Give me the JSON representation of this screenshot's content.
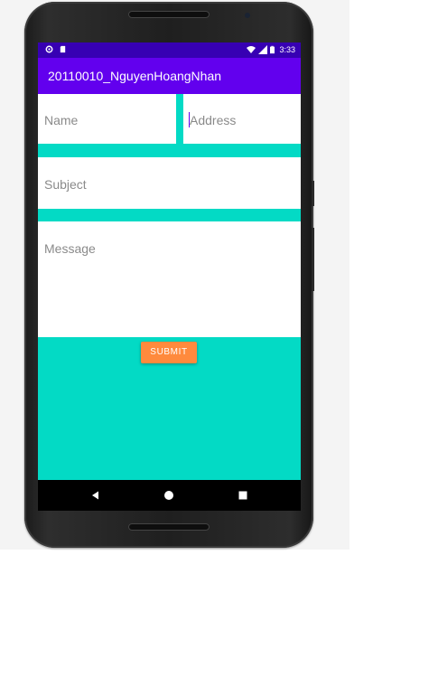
{
  "status_bar": {
    "left_icons": [
      "settings-gear-icon",
      "sd-card-icon"
    ],
    "right_icons": [
      "wifi-icon",
      "signal-icon",
      "battery-icon"
    ],
    "time": "3:33"
  },
  "app_bar": {
    "title": "20110010_NguyenHoangNhan"
  },
  "form": {
    "name": {
      "value": "",
      "placeholder": "Name"
    },
    "address": {
      "value": "",
      "placeholder": "Address"
    },
    "subject": {
      "value": "",
      "placeholder": "Subject"
    },
    "message": {
      "value": "",
      "placeholder": "Message"
    },
    "submit_label": "SUBMIT"
  },
  "nav_bar": {
    "icons": [
      "back-icon",
      "home-icon",
      "recents-icon"
    ]
  },
  "colors": {
    "status_bar": "#3700b3",
    "app_bar": "#6200ee",
    "content_background": "#03dac5",
    "submit_button": "#ff8a3d",
    "field_background": "#ffffff",
    "placeholder_text": "#8a8a8a"
  }
}
